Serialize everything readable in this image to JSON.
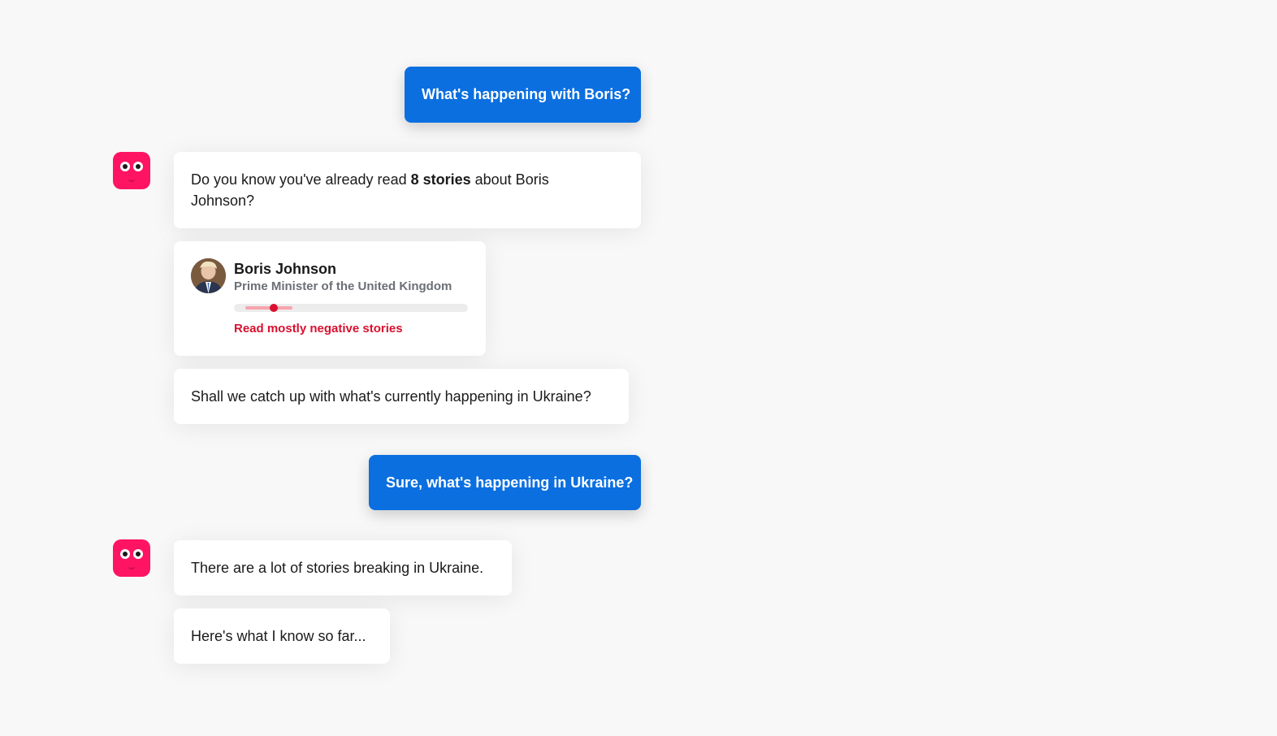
{
  "messages": {
    "user_1": "What's happening with Boris?",
    "bot_1_prefix": "Do you know you've already read ",
    "bot_1_bold": "8 stories",
    "bot_1_suffix": " about Boris Johnson?",
    "bot_2": "Shall we catch up with what's currently happening in Ukraine?",
    "user_2": "Sure, what's happening in Ukraine?",
    "bot_3": "There are a lot of stories breaking in Ukraine.",
    "bot_4": "Here's what I know so far..."
  },
  "person_card": {
    "name": "Boris Johnson",
    "role": "Prime Minister of the United Kingdom",
    "sentiment_label": "Read mostly negative stories",
    "sentiment_value": 0.17,
    "sentiment_range": [
      0.05,
      0.25
    ]
  },
  "colors": {
    "user_bubble": "#0b6fe0",
    "bot_avatar": "#ff1464",
    "negative": "#d9102f",
    "background": "#f8f8f8"
  },
  "icons": {
    "bot_avatar": "bot-face-icon",
    "person_photo": "person-photo"
  }
}
